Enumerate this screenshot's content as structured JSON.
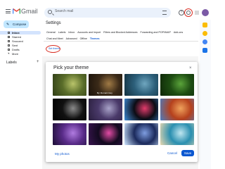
{
  "header": {
    "brand": "Gmail",
    "search_placeholder": "Search mail",
    "help_glyph": "?"
  },
  "nav": {
    "compose": "Compose",
    "items": [
      {
        "label": "Inbox",
        "active": true
      },
      {
        "label": "Starred"
      },
      {
        "label": "Snoozed"
      },
      {
        "label": "Sent"
      },
      {
        "label": "Drafts"
      },
      {
        "label": "More"
      }
    ],
    "labels_header": "Labels",
    "labels_add": "+"
  },
  "settings": {
    "title": "Settings",
    "tabs_row1": [
      "General",
      "Labels",
      "Inbox",
      "Accounts and Import",
      "Filters and Blocked Addresses",
      "Forwarding and POP/IMAP",
      "Add-ons"
    ],
    "tabs_row2": [
      "Chat and Meet",
      "Advanced",
      "Offline",
      "Themes"
    ],
    "active_tab": "Themes",
    "set_theme_link": "Set theme"
  },
  "theme_modal": {
    "title": "Pick your theme",
    "close_glyph": "×",
    "featured_credit": "By: Romain Guy",
    "my_photos": "My photos",
    "cancel": "Cancel",
    "save": "Save",
    "thumbnails": [
      {
        "name": "light-rays",
        "colors": [
          "#5a6d2a",
          "#b9c46a",
          "#2f3d16"
        ]
      },
      {
        "name": "chess",
        "colors": [
          "#3b2a18",
          "#a07a45",
          "#1a120a"
        ]
      },
      {
        "name": "ocean-rocks",
        "colors": [
          "#2c5f7a",
          "#6fa6bf",
          "#13303f"
        ]
      },
      {
        "name": "leaf-macro",
        "colors": [
          "#1e4d12",
          "#5aa33a",
          "#0e2608"
        ]
      },
      {
        "name": "bubbles",
        "colors": [
          "#111111",
          "#8a8a8a",
          "#000000"
        ]
      },
      {
        "name": "hummingbird",
        "colors": [
          "#4a3a6a",
          "#a9a3c9",
          "#2a1f3e"
        ]
      },
      {
        "name": "lanterns",
        "colors": [
          "#0c0c14",
          "#e23b6b",
          "#3e8ad6"
        ]
      },
      {
        "name": "red-canyon",
        "colors": [
          "#b5411d",
          "#f0a25c",
          "#4a7cc0"
        ]
      },
      {
        "name": "purple-sky",
        "colors": [
          "#5a2c8a",
          "#b07be0",
          "#1b0d33"
        ]
      },
      {
        "name": "pink-ribbon",
        "colors": [
          "#120a1f",
          "#e24ba5",
          "#3a1550"
        ]
      },
      {
        "name": "galaxy",
        "colors": [
          "#1b2a5c",
          "#7e9de0",
          "#cfe7ff"
        ]
      },
      {
        "name": "beach",
        "colors": [
          "#2a8fb0",
          "#bfe6f0",
          "#e9d8b0"
        ]
      },
      {
        "name": "tree",
        "colors": [
          "#0f2d1c",
          "#2b6b3c",
          "#71b86a"
        ]
      },
      {
        "name": "cloud",
        "colors": [
          "#7ab5e8",
          "#e3f2ff",
          "#4d8fc9"
        ]
      },
      {
        "name": "night",
        "colors": [
          "#0a1224",
          "#2a3f6e",
          "#000000"
        ]
      }
    ]
  }
}
